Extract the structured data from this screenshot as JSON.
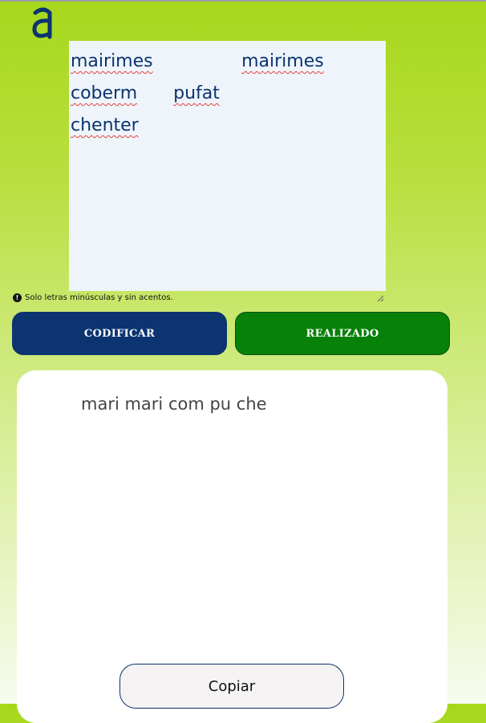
{
  "logo": {
    "glyph": "a",
    "color": "#0b3470"
  },
  "input": {
    "words": [
      "mairimes",
      "mairimes",
      "coberm",
      "pufat",
      "chenter"
    ]
  },
  "hint": {
    "text": "Solo letras minúsculas y sin acentos."
  },
  "buttons": {
    "encode": "CODIFICAR",
    "done": "REALIZADO"
  },
  "output": {
    "text": "mari mari com pu che",
    "copy": "Copiar"
  },
  "colors": {
    "primary": "#0b3470",
    "success": "#078107"
  }
}
